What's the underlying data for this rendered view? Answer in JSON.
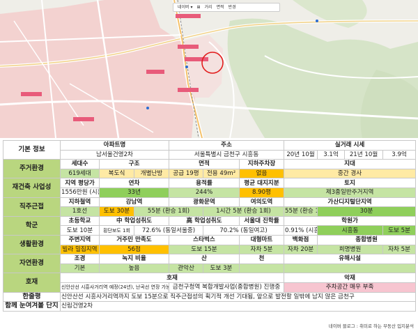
{
  "map": {
    "toolbar_items": [
      "네이버 ▾",
      "⊞",
      "거리",
      "면적",
      "반경"
    ]
  },
  "rows": [
    {
      "name": "basic-info",
      "cells": [
        {
          "t": "기본 정보",
          "c": "cat-w",
          "rs": 2,
          "cs": 2
        },
        {
          "t": "아파트명",
          "c": "hd",
          "cs": 3
        },
        {
          "t": "주소",
          "c": "hd",
          "cs": 3
        },
        {
          "t": "실거래 시세",
          "c": "hd",
          "cs": 4
        }
      ]
    },
    {
      "name": "basic-info-values",
      "cells": [
        {
          "t": "남서울건영2차",
          "cs": 3
        },
        {
          "t": "서울특별시 금천구 시흥동",
          "cs": 3
        },
        {
          "t": "20년 10월"
        },
        {
          "t": "3.1억"
        },
        {
          "t": "21년 10월"
        },
        {
          "t": "3.9억"
        }
      ]
    },
    {
      "name": "living-env",
      "cells": [
        {
          "t": "주거환경",
          "c": "cat",
          "rs": 2,
          "cs": 2
        },
        {
          "t": "세대수",
          "c": "hd"
        },
        {
          "t": "구조",
          "c": "hd",
          "cs": 2
        },
        {
          "t": "면적",
          "c": "hd",
          "cs": 2
        },
        {
          "t": "지하주차장",
          "c": "hd"
        },
        {
          "t": "지대",
          "c": "hd",
          "cs": 4
        }
      ]
    },
    {
      "name": "living-env-values",
      "cells": [
        {
          "t": "619세대",
          "c": "lg"
        },
        {
          "t": "복도식",
          "c": "ly"
        },
        {
          "t": "개별난방",
          "c": "ly"
        },
        {
          "t": "공급 19평",
          "c": "ly"
        },
        {
          "t": "전용 49m²",
          "c": "ly"
        },
        {
          "t": "없음",
          "c": "y"
        },
        {
          "t": "중간 경사",
          "c": "ly",
          "cs": 4
        }
      ]
    },
    {
      "name": "rebuild",
      "cells": [
        {
          "t": "재건축 사업성",
          "c": "cat",
          "rs": 2,
          "cs": 2
        },
        {
          "t": "지역 평당가",
          "c": "hd"
        },
        {
          "t": "연차",
          "c": "hd",
          "cs": 2
        },
        {
          "t": "용적률",
          "c": "hd",
          "cs": 2
        },
        {
          "t": "평균 대지지분",
          "c": "hd"
        },
        {
          "t": "토지",
          "c": "hd",
          "cs": 4
        }
      ]
    },
    {
      "name": "rebuild-values",
      "cells": [
        {
          "t": "1556만원 (시흥동)"
        },
        {
          "t": "33년",
          "c": "g",
          "cs": 2
        },
        {
          "t": "244%",
          "c": "lg",
          "cs": 2
        },
        {
          "t": "8.90평",
          "c": "y"
        },
        {
          "t": "제3종일반주거지역",
          "c": "lg",
          "cs": 4
        }
      ]
    },
    {
      "name": "commute",
      "cells": [
        {
          "t": "직주근접",
          "c": "cat",
          "rs": 2,
          "cs": 2
        },
        {
          "t": "지하철역",
          "c": "hd"
        },
        {
          "t": "강남역",
          "c": "hd",
          "cs": 2
        },
        {
          "t": "광화문역",
          "c": "hd",
          "cs": 2
        },
        {
          "t": "여의도역",
          "c": "hd"
        },
        {
          "t": "가산디지털단지역",
          "c": "hd",
          "cs": 4
        }
      ]
    },
    {
      "name": "commute-values",
      "cells": [
        {
          "t": "1호선",
          "c": "lg"
        },
        {
          "t": "도보 30분",
          "c": "y"
        },
        {
          "t": "55분 (환승 1회)",
          "c": "lg",
          "cs": 2
        },
        {
          "t": "1시간 5분 (환승 1회)",
          "c": "lg",
          "cs": 2
        },
        {
          "t": "55분 (환승 1회)",
          "c": "lg"
        },
        {
          "t": "30분",
          "c": "g",
          "cs": 4
        }
      ]
    },
    {
      "name": "school",
      "cells": [
        {
          "t": "학군",
          "c": "cat",
          "rs": 2,
          "cs": 2
        },
        {
          "t": "초등학교",
          "c": "hd"
        },
        {
          "t": "中 학업성취도",
          "c": "hd",
          "cs": 2
        },
        {
          "t": "高 학업성취도",
          "c": "hd",
          "cs": 2
        },
        {
          "t": "서울대 진학률",
          "c": "hd"
        },
        {
          "t": "학원가",
          "c": "hd",
          "cs": 4
        }
      ]
    },
    {
      "name": "school-values",
      "cells": [
        {
          "t": "도보 10분"
        },
        {
          "t": "횡단보도 1회",
          "c": "small"
        },
        {
          "t": "72.6% (동일서울중)",
          "cs": 2
        },
        {
          "t": "70.2% (동일여고)",
          "cs": 2
        },
        {
          "t": "0.91% (시흥동)"
        },
        {
          "t": "시흥동",
          "c": "g",
          "cs": 2
        },
        {
          "t": "도보 5분",
          "c": "g",
          "cs": 2
        }
      ]
    },
    {
      "name": "lifestyle",
      "cells": [
        {
          "t": "생활환경",
          "c": "cat",
          "rs": 2,
          "cs": 2
        },
        {
          "t": "주변지역",
          "c": "hd"
        },
        {
          "t": "거주민 만족도",
          "c": "hd",
          "cs": 2
        },
        {
          "t": "스타벅스",
          "c": "hd",
          "cs": 2
        },
        {
          "t": "대형마트",
          "c": "hd"
        },
        {
          "t": "백화점",
          "c": "hd"
        },
        {
          "t": "종합병원",
          "c": "hd",
          "cs": 3
        }
      ]
    },
    {
      "name": "lifestyle-values",
      "cells": [
        {
          "t": "빌라 밀집지역",
          "c": "y"
        },
        {
          "t": "56점",
          "c": "y",
          "cs": 2
        },
        {
          "t": "도보 15분",
          "c": "lg",
          "cs": 2
        },
        {
          "t": "자차 5분",
          "c": "lg"
        },
        {
          "t": "자차 20분",
          "c": "lg"
        },
        {
          "t": "희명병원",
          "c": "lg",
          "cs": 2
        },
        {
          "t": "자차 5분",
          "c": "lg"
        }
      ]
    },
    {
      "name": "nature",
      "cells": [
        {
          "t": "자연환경",
          "c": "cat",
          "rs": 2,
          "cs": 2
        },
        {
          "t": "조경",
          "c": "hd"
        },
        {
          "t": "녹지 비율",
          "c": "hd",
          "cs": 2
        },
        {
          "t": "산",
          "c": "hd",
          "cs": 2
        },
        {
          "t": "천",
          "c": "hd"
        },
        {
          "t": "유해시설",
          "c": "hd",
          "cs": 4
        }
      ]
    },
    {
      "name": "nature-values",
      "cells": [
        {
          "t": "기본",
          "c": "lg"
        },
        {
          "t": "높음",
          "c": "lg",
          "cs": 2
        },
        {
          "t": "관악산",
          "c": "lg"
        },
        {
          "t": "도보 3분",
          "c": "lg"
        },
        {
          "t": "",
          "c": "lg"
        },
        {
          "t": "",
          "c": "lg",
          "cs": 4
        }
      ]
    },
    {
      "name": "positive",
      "cells": [
        {
          "t": "호재",
          "c": "cat",
          "rs": 2,
          "cs": 2
        },
        {
          "t": "호재",
          "c": "hd",
          "cs": 6
        },
        {
          "t": "악재",
          "c": "hd",
          "cs": 4
        }
      ]
    },
    {
      "name": "positive-values",
      "cells": [
        {
          "t": "신안산선 시흥사거리역 예정(24년), 난곡선 연장 가능성",
          "c": "small",
          "cs": 3
        },
        {
          "t": "금천구청역 복합개발사업(종합병원) 진행중",
          "cs": 3
        },
        {
          "t": "주차공간 매우 부족",
          "c": "pk",
          "cs": 4
        }
      ]
    },
    {
      "name": "summary",
      "cells": [
        {
          "t": "한줄평",
          "c": "cat-w",
          "cs": 2
        },
        {
          "t": "신안산선 시흥사거리역까지 도보 15분으로 직주근접성의 획기적 개선 기대됨, 앞으로 발전할 일밖에 남지 않은 금천구",
          "c": "left",
          "cs": 10
        }
      ]
    },
    {
      "name": "compare",
      "cells": [
        {
          "t": "함께 눈여겨볼 단지",
          "c": "cat-w",
          "cs": 2
        },
        {
          "t": "신림건영2차",
          "c": "left",
          "cs": 10
        }
      ]
    }
  ],
  "footer": "네이버 블로그 : 취미로 하는 부동산 입지분석"
}
